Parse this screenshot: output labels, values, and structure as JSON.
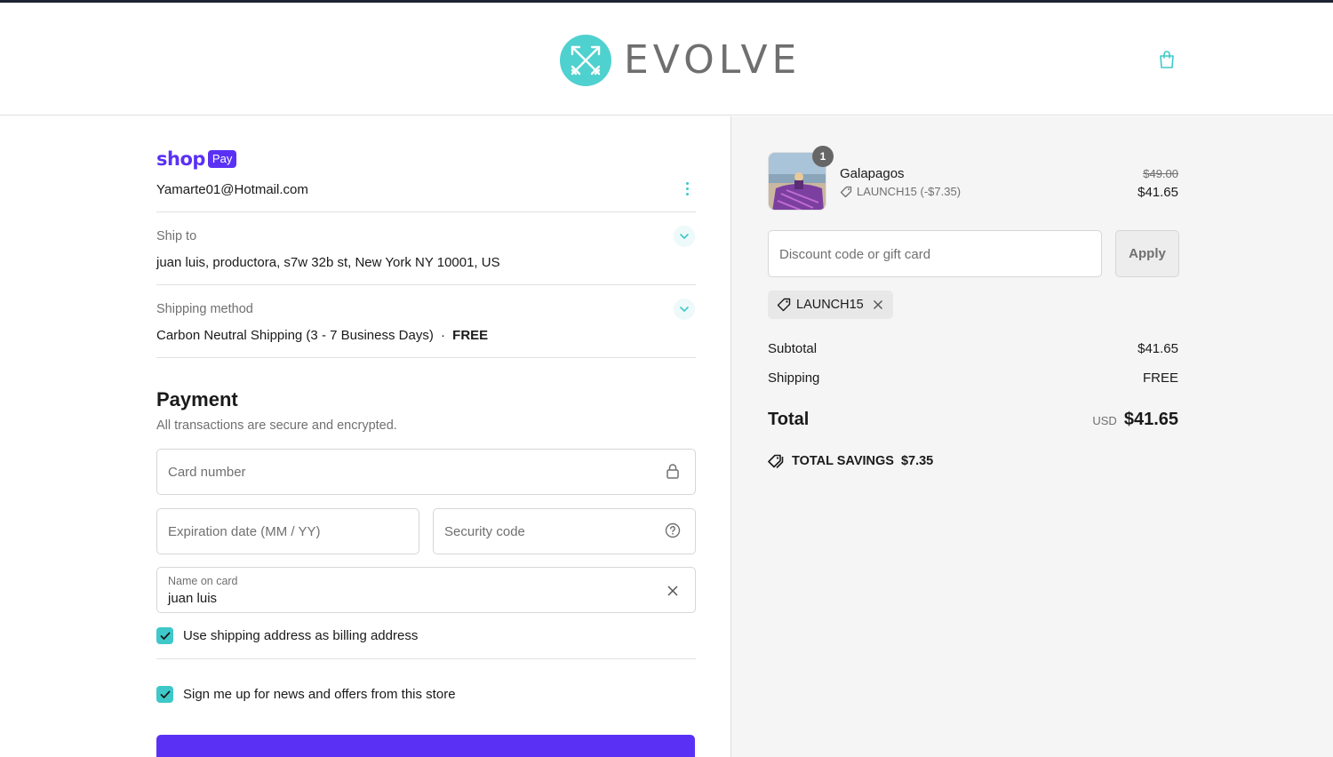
{
  "header": {
    "brand": "EVOLVE",
    "cart_icon": "shopping-bag-icon"
  },
  "contact": {
    "shop_word": "shop",
    "pay_word": "Pay",
    "email": "Yamarte01@Hotmail.com",
    "menu_icon": "kebab-menu-icon"
  },
  "ship_to": {
    "label": "Ship to",
    "value": "juan luis, productora, s7w 32b st, New York NY 10001, US"
  },
  "shipping_method": {
    "label": "Shipping method",
    "value": "Carbon Neutral Shipping (3 - 7 Business Days)",
    "separator": "·",
    "price": "FREE"
  },
  "payment": {
    "title": "Payment",
    "subtitle": "All transactions are secure and encrypted.",
    "card_number_placeholder": "Card number",
    "expiration_placeholder": "Expiration date (MM / YY)",
    "security_placeholder": "Security code",
    "name_label": "Name on card",
    "name_value": "juan luis",
    "billing_checkbox_label": "Use shipping address as billing address",
    "billing_checked": true,
    "news_checkbox_label": "Sign me up for news and offers from this store",
    "news_checked": true
  },
  "order": {
    "item_name": "Galapagos",
    "quantity": "1",
    "item_discount": "LAUNCH15 (-$7.35)",
    "price_original": "$49.00",
    "price_final": "$41.65",
    "discount_placeholder": "Discount code or gift card",
    "apply_label": "Apply",
    "applied_code": "LAUNCH15",
    "subtotal_label": "Subtotal",
    "subtotal_value": "$41.65",
    "shipping_label": "Shipping",
    "shipping_value": "FREE",
    "total_label": "Total",
    "total_currency": "USD",
    "total_value": "$41.65",
    "savings_label": "TOTAL SAVINGS",
    "savings_value": "$7.35"
  },
  "colors": {
    "accent_teal": "#3fc8c9",
    "shop_purple": "#5a31f4",
    "panel_gray": "#f5f5f5"
  }
}
